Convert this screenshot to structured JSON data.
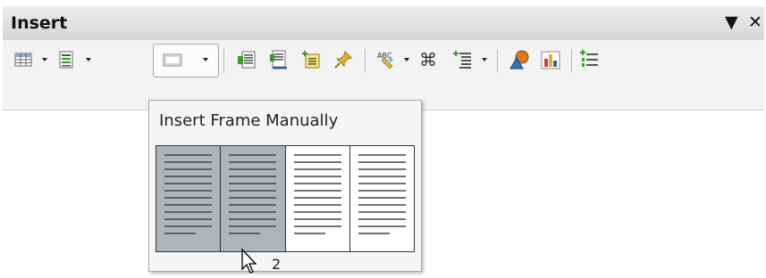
{
  "toolbar": {
    "title": "Insert",
    "menu_glyph": "▼",
    "close_glyph": "✕",
    "buttons": [
      {
        "name": "table-icon",
        "has_dropdown": true
      },
      {
        "name": "section-icon",
        "has_dropdown": true
      },
      {
        "name": "frame-icon",
        "has_dropdown": true,
        "pressed": true
      },
      {
        "name": "fields-icon"
      },
      {
        "name": "footnote-icon"
      },
      {
        "name": "note-icon"
      },
      {
        "name": "pin-icon"
      },
      {
        "name": "spelling-icon",
        "has_dropdown": true
      },
      {
        "name": "special-character-icon"
      },
      {
        "name": "insert-index-icon",
        "has_dropdown": true
      },
      {
        "name": "draw-shapes-icon"
      },
      {
        "name": "chart-icon"
      },
      {
        "name": "bullets-icon"
      }
    ]
  },
  "popup": {
    "title": "Insert Frame Manually",
    "columns_total": 4,
    "columns_selected": 2,
    "count_label": "2"
  },
  "colors": {
    "selected_column": "#b0b3ba",
    "unselected_column": "#ffffff",
    "accent_green": "#3d9b2f",
    "accent_blue": "#2f5fbf"
  }
}
